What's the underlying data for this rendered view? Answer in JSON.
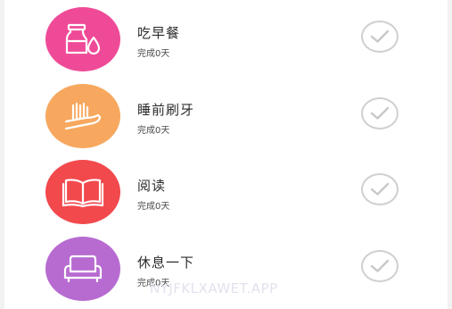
{
  "colors": {
    "breakfast": "#ef4a98",
    "brush_teeth": "#f7a85e",
    "reading": "#f2494d",
    "rest": "#b76bd0",
    "check": "#c8c8c8"
  },
  "habits": [
    {
      "name": "吃早餐",
      "status": "完成0天",
      "icon": "milk-bottle-icon"
    },
    {
      "name": "睡前刷牙",
      "status": "完成0天",
      "icon": "toothbrush-icon"
    },
    {
      "name": "阅读",
      "status": "完成0天",
      "icon": "open-book-icon"
    },
    {
      "name": "休息一下",
      "status": "完成0天",
      "icon": "sofa-icon"
    }
  ],
  "watermark": "NYJFKLXAWET.APP"
}
